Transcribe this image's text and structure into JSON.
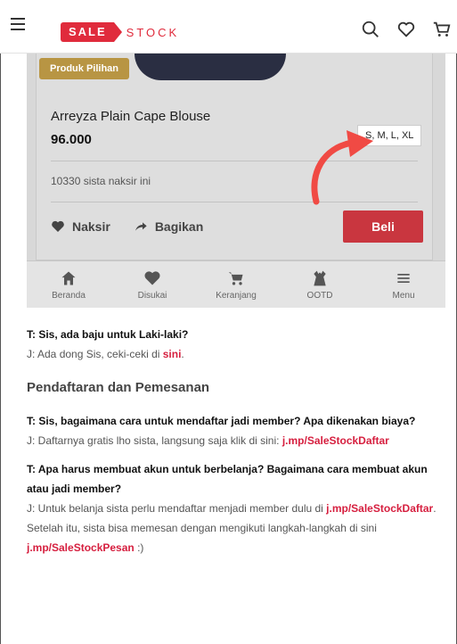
{
  "header": {
    "logo_sale": "SALE",
    "logo_stock": "STOCK",
    "icons": [
      "menu-icon",
      "search-icon",
      "heart-icon",
      "cart-icon"
    ]
  },
  "product": {
    "badge": "Produk Pilihan",
    "name": "Arreyza Plain Cape Blouse",
    "price": "96.000",
    "sizes": "S, M, L, XL",
    "likes": "10330 sista naksir ini",
    "naksir_label": "Naksir",
    "bagikan_label": "Bagikan",
    "beli_label": "Beli"
  },
  "tabbar": {
    "items": [
      {
        "label": "Beranda",
        "icon": "home-icon"
      },
      {
        "label": "Disukai",
        "icon": "heart-icon"
      },
      {
        "label": "Keranjang",
        "icon": "cart-icon"
      },
      {
        "label": "OOTD",
        "icon": "dress-icon"
      },
      {
        "label": "Menu",
        "icon": "menu-icon"
      }
    ]
  },
  "faq": {
    "q1": "T: Sis, ada baju untuk Laki-laki?",
    "a1_pre": "J: Ada dong Sis, ceki-ceki di ",
    "a1_link": "sini",
    "a1_post": ".",
    "section": "Pendaftaran dan Pemesanan",
    "q2": "T: Sis, bagaimana cara untuk mendaftar jadi member? Apa dikenakan biaya?",
    "a2_pre": "J: Daftarnya gratis lho sista, langsung saja klik di sini: ",
    "a2_link": "j.mp/SaleStockDaftar",
    "q3": "T: Apa harus membuat akun untuk berbelanja? Bagaimana cara membuat akun atau jadi member?",
    "a3_pre": "J: Untuk belanja sista perlu mendaftar menjadi member dulu di ",
    "a3_link1": "j.mp/SaleStockDaftar",
    "a3_mid": ". Setelah itu, sista bisa memesan dengan mengikuti langkah-langkah di sini ",
    "a3_link2": "j.mp/SaleStockPesan",
    "a3_post": "  :)"
  },
  "colors": {
    "brand_red": "#e02b3c",
    "link_red": "#d61f3f",
    "badge_gold": "#b89543",
    "beli_red": "#c9363f"
  }
}
